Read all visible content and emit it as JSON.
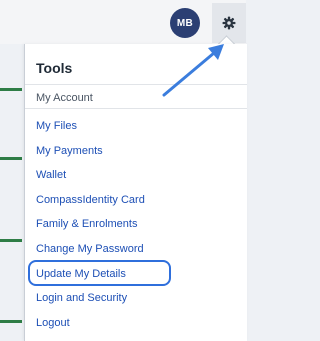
{
  "header": {
    "avatar_initials": "MB"
  },
  "menu": {
    "title": "Tools",
    "section_label": "My Account",
    "items": [
      {
        "label": "My Files"
      },
      {
        "label": "My Payments"
      },
      {
        "label": "Wallet"
      },
      {
        "label": "CompassIdentity Card"
      },
      {
        "label": "Family & Enrolments"
      },
      {
        "label": "Change My Password"
      },
      {
        "label": "Update My Details",
        "highlighted": true
      },
      {
        "label": "Login and Security"
      },
      {
        "label": "Logout"
      }
    ]
  },
  "icons": {
    "settings": "gear-icon"
  },
  "colors": {
    "avatar_bg": "#2b3f73",
    "link": "#1d4fb5",
    "highlight_outline": "#2f6fdc",
    "annotation_arrow": "#3b7ddd"
  }
}
